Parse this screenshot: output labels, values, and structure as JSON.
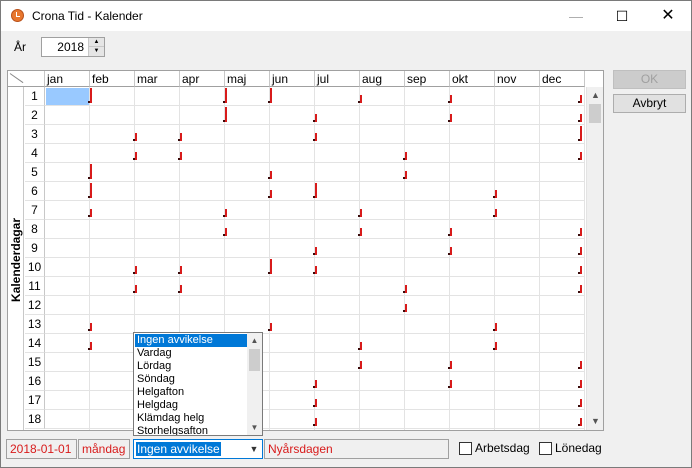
{
  "window": {
    "title": "Crona Tid - Kalender",
    "minimize_icon": "—",
    "maximize_icon": "☐",
    "close_icon": "✕"
  },
  "year": {
    "label": "År",
    "value": "2018"
  },
  "grid": {
    "months": [
      "jan",
      "feb",
      "mar",
      "apr",
      "maj",
      "jun",
      "jul",
      "aug",
      "sep",
      "okt",
      "nov",
      "dec"
    ],
    "side_label": "Kalenderdagar",
    "days": [
      "1",
      "2",
      "3",
      "4",
      "5",
      "6",
      "7",
      "8",
      "9",
      "10",
      "11",
      "12",
      "13",
      "14",
      "15",
      "16",
      "17",
      "18"
    ]
  },
  "dropdown": {
    "options": [
      "Ingen avvikelse",
      "Vardag",
      "Lördag",
      "Söndag",
      "Helgafton",
      "Helgdag",
      "Klämdag helg",
      "Storhelgsafton"
    ],
    "selected_index": 0
  },
  "buttons": {
    "ok": "OK",
    "cancel": "Avbryt"
  },
  "status": {
    "date": "2018-01-01",
    "weekday": "måndag",
    "deviation": "Ingen avvikelse",
    "holiday": "Nyårsdagen",
    "workday_label": "Arbetsdag",
    "payday_label": "Lönedag"
  },
  "colors": {
    "mark": "#d81b1b",
    "selection": "#99c9ff",
    "accent": "#0078d7"
  }
}
